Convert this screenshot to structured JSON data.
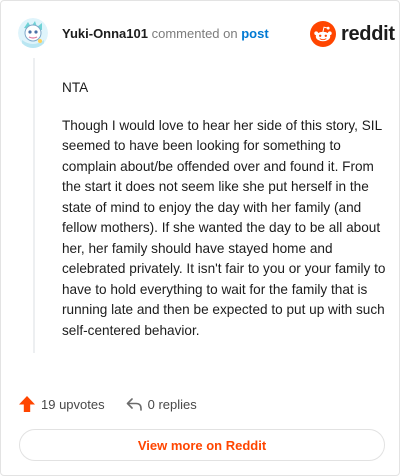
{
  "header": {
    "username": "Yuki-Onna101",
    "commented_text": "commented on",
    "post_link": "post",
    "brand": "reddit"
  },
  "comment": {
    "paragraphs": [
      "NTA",
      "Though I would love to hear her side of this story, SIL seemed to have been looking for something to complain about/be offended over and found it. From the start it does not seem like she put herself in the state of mind to enjoy the day with her family (and fellow mothers). If she wanted the day to be all about her, her family should have stayed home and celebrated privately. It isn't fair to you or your family to have to hold everything to wait for the family that is running late and then be expected to put up with such self-centered behavior."
    ]
  },
  "actions": {
    "upvotes": "19 upvotes",
    "replies": "0 replies"
  },
  "footer": {
    "view_more": "View more on Reddit"
  },
  "colors": {
    "accent": "#ff4500",
    "link": "#0079d3"
  },
  "icons": {
    "avatar": "snoo-avatar",
    "brand": "reddit-logo-icon",
    "upvote": "upvote-arrow-icon",
    "reply": "reply-arrow-icon"
  }
}
